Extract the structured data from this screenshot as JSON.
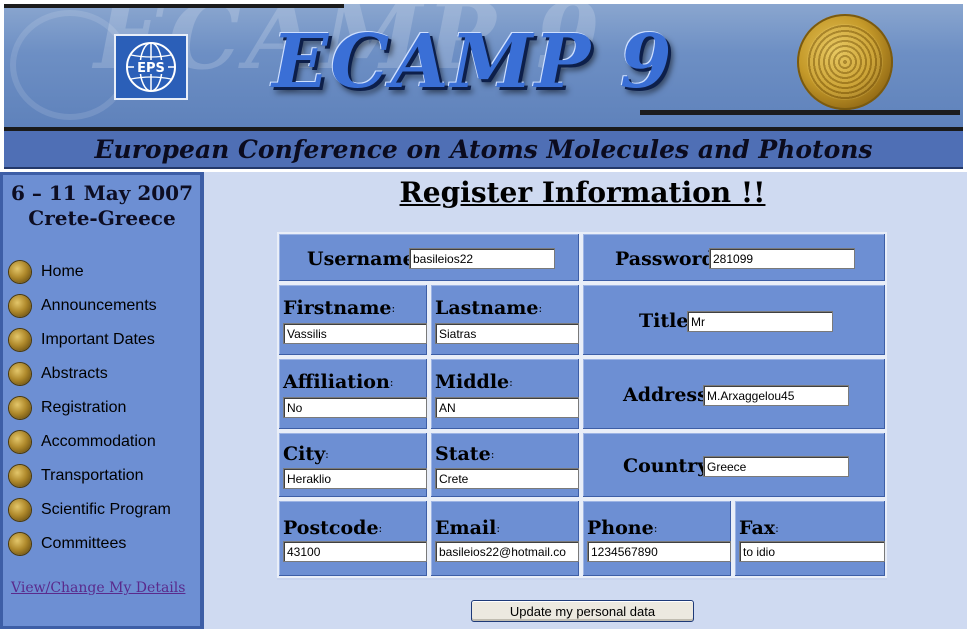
{
  "banner": {
    "logo_text": "EPS",
    "conference_name": "ECAMP 9",
    "subtitle": "European Conference on Atoms Molecules and Photons"
  },
  "sidebar": {
    "dates": "6 – 11 May 2007",
    "location": "Crete-Greece",
    "items": [
      {
        "label": "Home"
      },
      {
        "label": "Announcements"
      },
      {
        "label": "Important Dates"
      },
      {
        "label": "Abstracts"
      },
      {
        "label": "Registration"
      },
      {
        "label": "Accommodation"
      },
      {
        "label": "Transportation"
      },
      {
        "label": "Scientific Program"
      },
      {
        "label": "Committees"
      }
    ],
    "details_link": "View/Change My Details"
  },
  "main": {
    "title": "Register Information !!",
    "form": {
      "username": {
        "label": "Username",
        "value": "basileios22"
      },
      "password": {
        "label": "Password",
        "value": "281099"
      },
      "firstname": {
        "label": "Firstname",
        "value": "Vassilis"
      },
      "lastname": {
        "label": "Lastname",
        "value": "Siatras"
      },
      "title": {
        "label": "Title",
        "value": "Mr"
      },
      "affiliation": {
        "label": "Affiliation",
        "value": "No"
      },
      "middle": {
        "label": "Middle",
        "value": "AN"
      },
      "address": {
        "label": "Address",
        "value": "M.Arxaggelou45"
      },
      "city": {
        "label": "City",
        "value": "Heraklio"
      },
      "state": {
        "label": "State",
        "value": "Crete"
      },
      "country": {
        "label": "Country",
        "value": "Greece"
      },
      "postcode": {
        "label": "Postcode",
        "value": "43100"
      },
      "email": {
        "label": "Email",
        "value": "basileios22@hotmail.co"
      },
      "phone": {
        "label": "Phone",
        "value": "1234567890"
      },
      "fax": {
        "label": "Fax",
        "value": "to idio"
      }
    },
    "update_button": "Update my personal data"
  }
}
